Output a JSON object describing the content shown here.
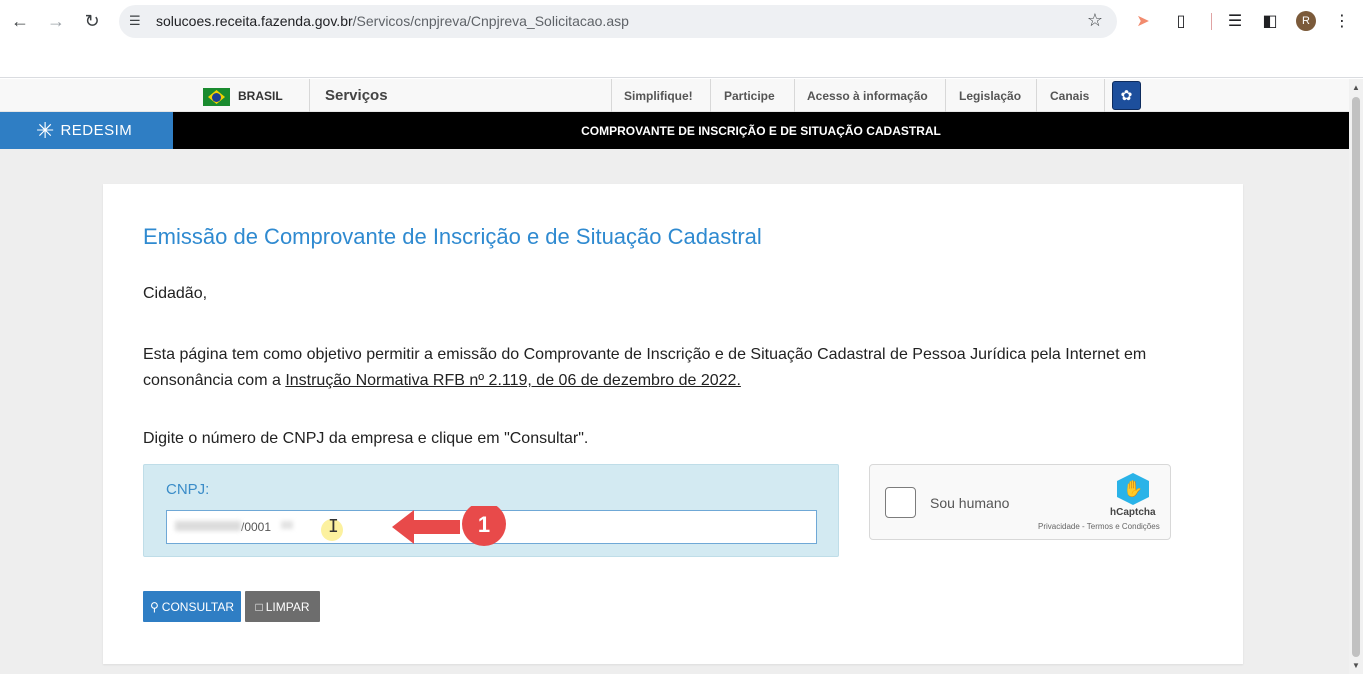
{
  "browser": {
    "url_domain": "solucoes.receita.fazenda.gov.br",
    "url_path": "/Servicos/cnpjreva/Cnpjreva_Solicitacao.asp",
    "profile_initial": "R"
  },
  "govbar": {
    "country": "BRASIL",
    "services": "Serviços",
    "links": [
      "Simplifique!",
      "Participe",
      "Acesso à informação",
      "Legislação",
      "Canais"
    ]
  },
  "header": {
    "logo_text": "REDESIM",
    "title": "COMPROVANTE DE INSCRIÇÃO E DE SITUAÇÃO CADASTRAL"
  },
  "main": {
    "heading": "Emissão de Comprovante de Inscrição e de Situação Cadastral",
    "greeting": "Cidadão,",
    "paragraph_text": "Esta página tem como objetivo permitir a emissão do Comprovante de Inscrição e de Situação Cadastral de Pessoa Jurídica pela Internet em consonância com a ",
    "paragraph_link": "Instrução Normativa RFB nº 2.119, de 06 de dezembro de 2022.",
    "instruction": "Digite o número de CNPJ da empresa e clique em \"Consultar\".",
    "cnpj_label": "CNPJ:",
    "cnpj_value_visible": "/0001",
    "annotation_number": "1",
    "consultar_label": "CONSULTAR",
    "limpar_label": "LIMPAR"
  },
  "captcha": {
    "label": "Sou humano",
    "brand": "hCaptcha",
    "links": "Privacidade - Termos e Condições"
  },
  "colors": {
    "accent_blue": "#2f7ec4",
    "heading_blue": "#2f8ad0",
    "annotation_red": "#e84a4a",
    "input_box_bg": "#d3eaf2"
  }
}
